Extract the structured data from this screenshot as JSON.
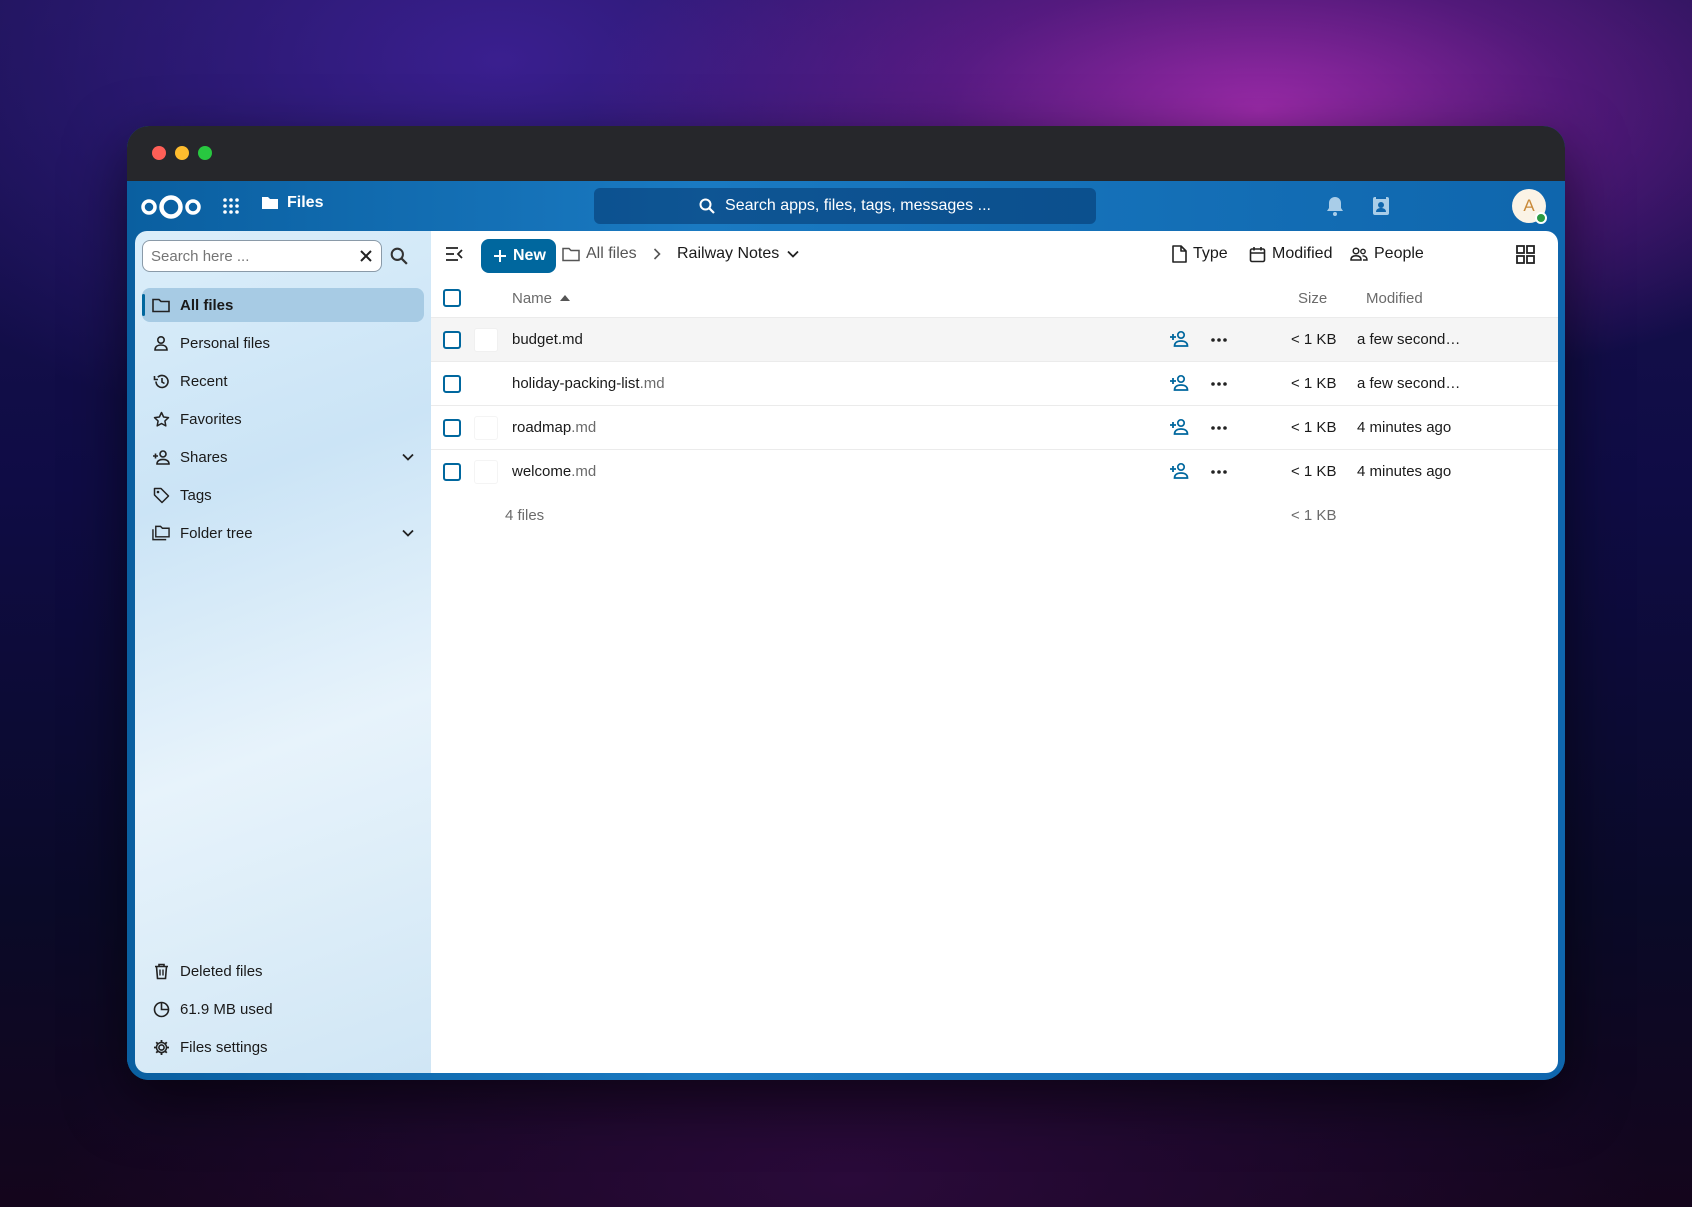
{
  "header": {
    "app_name": "Files",
    "search_placeholder": "Search apps, files, tags, messages ...",
    "avatar_initial": "A"
  },
  "sidebar": {
    "search_placeholder": "Search here ...",
    "items": [
      {
        "label": "All files",
        "icon": "folder-icon",
        "active": true
      },
      {
        "label": "Personal files",
        "icon": "person-icon"
      },
      {
        "label": "Recent",
        "icon": "history-icon"
      },
      {
        "label": "Favorites",
        "icon": "star-icon"
      },
      {
        "label": "Shares",
        "icon": "share-icon",
        "expandable": true
      },
      {
        "label": "Tags",
        "icon": "tag-icon"
      },
      {
        "label": "Folder tree",
        "icon": "folder-tree-icon",
        "expandable": true
      }
    ],
    "bottom": {
      "deleted": "Deleted files",
      "quota": "61.9 MB used",
      "settings": "Files settings"
    }
  },
  "toolbar": {
    "new_label": "New",
    "breadcrumb": [
      "All files",
      "Railway Notes"
    ],
    "filters": [
      "Type",
      "Modified",
      "People"
    ]
  },
  "table": {
    "headers": {
      "name": "Name",
      "size": "Size",
      "modified": "Modified"
    },
    "rows": [
      {
        "base": "budget.md",
        "ext": "",
        "size": "< 1 KB",
        "modified": "a few seconds ago"
      },
      {
        "base": "holiday-packing-list",
        "ext": ".md",
        "size": "< 1 KB",
        "modified": "a few seconds ago"
      },
      {
        "base": "roadmap",
        "ext": ".md",
        "size": "< 1 KB",
        "modified": "4 minutes ago"
      },
      {
        "base": "welcome",
        "ext": ".md",
        "size": "< 1 KB",
        "modified": "4 minutes ago"
      }
    ],
    "summary": {
      "count": "4 files",
      "size": "< 1 KB"
    }
  },
  "colors": {
    "primary": "#00679e",
    "header": "#0082c9",
    "titlebar": "#26272b"
  }
}
